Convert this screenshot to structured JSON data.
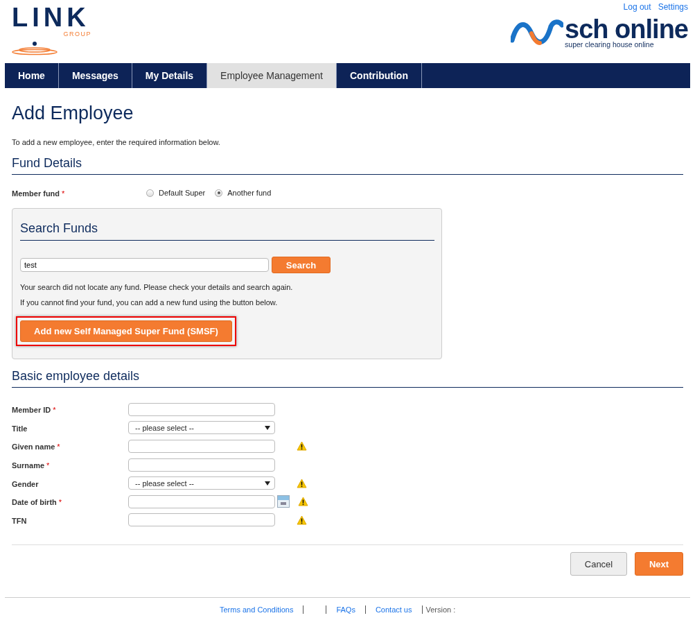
{
  "header": {
    "logo_left": {
      "name": "LINK",
      "sub": "GROUP"
    },
    "logo_right": {
      "name": "sch online",
      "tagline": "super clearing house online"
    },
    "links": [
      "Log out",
      "Settings"
    ]
  },
  "nav": [
    {
      "label": "Home",
      "selected": false
    },
    {
      "label": "Messages",
      "selected": false
    },
    {
      "label": "My Details",
      "selected": false
    },
    {
      "label": "Employee Management",
      "selected": true
    },
    {
      "label": "Contribution",
      "selected": false
    }
  ],
  "page": {
    "title": "Add Employee",
    "intro": "To add a new employee, enter the required information below."
  },
  "fund_details": {
    "heading": "Fund Details",
    "label": "Member fund",
    "required_mark": "*",
    "options": [
      {
        "label": "Default Super",
        "selected": false
      },
      {
        "label": "Another fund",
        "selected": true
      }
    ],
    "search": {
      "heading": "Search Funds",
      "value": "test",
      "button": "Search",
      "messages": [
        "Your search did not locate any fund. Please check your details and search again.",
        "If you cannot find your fund, you can add a new fund using the button below."
      ],
      "add_button": {
        "label": "Add new Self Managed Super Fund (SMSF)",
        "highlighted": true
      }
    }
  },
  "basic_details": {
    "heading": "Basic employee details",
    "fields": [
      {
        "label": "Member ID",
        "required_mark": "*",
        "kind": "text",
        "warning": false
      },
      {
        "label": "Title",
        "kind": "select",
        "value": "-- please select --",
        "warning": false
      },
      {
        "label": "Given name",
        "required_mark": "*",
        "kind": "text",
        "warning": true
      },
      {
        "label": "Surname",
        "required_mark": "*",
        "kind": "text",
        "warning": false
      },
      {
        "label": "Gender",
        "kind": "select",
        "value": "-- please select --",
        "warning": true
      },
      {
        "label": "Date of birth",
        "required_mark": "*",
        "kind": "date",
        "warning": true
      },
      {
        "label": "TFN",
        "kind": "text",
        "warning": true
      }
    ]
  },
  "buttons": [
    {
      "label": "Cancel",
      "kind": "secondary"
    },
    {
      "label": "Next",
      "kind": "primary"
    }
  ],
  "footer": {
    "links": [
      "Terms and Conditions",
      "FAQs",
      "Contact us"
    ],
    "version_label": "Version :"
  }
}
